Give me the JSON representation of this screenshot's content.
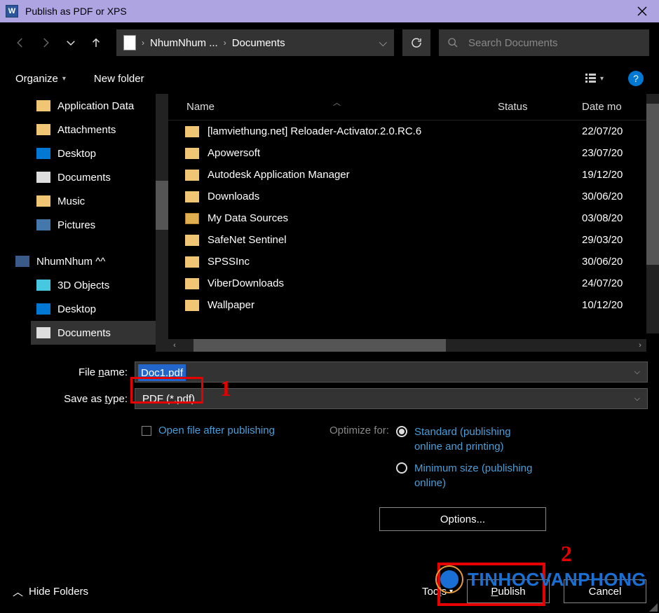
{
  "title": "Publish as PDF or XPS",
  "breadcrumb": {
    "seg1": "NhumNhum ...",
    "seg2": "Documents"
  },
  "search": {
    "placeholder": "Search Documents"
  },
  "toolbar": {
    "organize": "Organize",
    "newfolder": "New folder"
  },
  "columns": {
    "name": "Name",
    "status": "Status",
    "date": "Date mo"
  },
  "sidebar": {
    "items": [
      {
        "label": "Application Data",
        "icon": "folder"
      },
      {
        "label": "Attachments",
        "icon": "folder"
      },
      {
        "label": "Desktop",
        "icon": "desktop"
      },
      {
        "label": "Documents",
        "icon": "doc"
      },
      {
        "label": "Music",
        "icon": "folder"
      },
      {
        "label": "Pictures",
        "icon": "pic"
      }
    ],
    "computer": {
      "label": "NhumNhum ^^"
    },
    "items2": [
      {
        "label": "3D Objects",
        "icon": "3d"
      },
      {
        "label": "Desktop",
        "icon": "desktop"
      },
      {
        "label": "Documents",
        "icon": "doc"
      }
    ]
  },
  "files": [
    {
      "name": "[lamviethung.net] Reloader-Activator.2.0.RC.6",
      "date": "22/07/20",
      "icon": "folder"
    },
    {
      "name": "Apowersoft",
      "date": "23/07/20",
      "icon": "folder"
    },
    {
      "name": "Autodesk Application Manager",
      "date": "19/12/20",
      "icon": "folder"
    },
    {
      "name": "Downloads",
      "date": "30/06/20",
      "icon": "folder"
    },
    {
      "name": "My Data Sources",
      "date": "03/08/20",
      "icon": "special"
    },
    {
      "name": "SafeNet Sentinel",
      "date": "29/03/20",
      "icon": "folder"
    },
    {
      "name": "SPSSInc",
      "date": "30/06/20",
      "icon": "folder"
    },
    {
      "name": "ViberDownloads",
      "date": "24/07/20",
      "icon": "folder"
    },
    {
      "name": "Wallpaper",
      "date": "10/12/20",
      "icon": "folder"
    }
  ],
  "form": {
    "filename_label": "File name:",
    "filename_value": "Doc1.pdf",
    "savetype_label": "Save as type:",
    "savetype_value": "PDF (*.pdf)",
    "openafter": "Open file after publishing",
    "optimize_label": "Optimize for:",
    "opt_standard": "Standard (publishing online and printing)",
    "opt_minimum": "Minimum size (publishing online)",
    "options_btn": "Options..."
  },
  "footer": {
    "hidefolders": "Hide Folders",
    "tools": "Tools",
    "publish": "Publish",
    "cancel": "Cancel"
  },
  "annotations": {
    "one": "1",
    "two": "2"
  },
  "watermark": "TINHOCVANPHONG"
}
